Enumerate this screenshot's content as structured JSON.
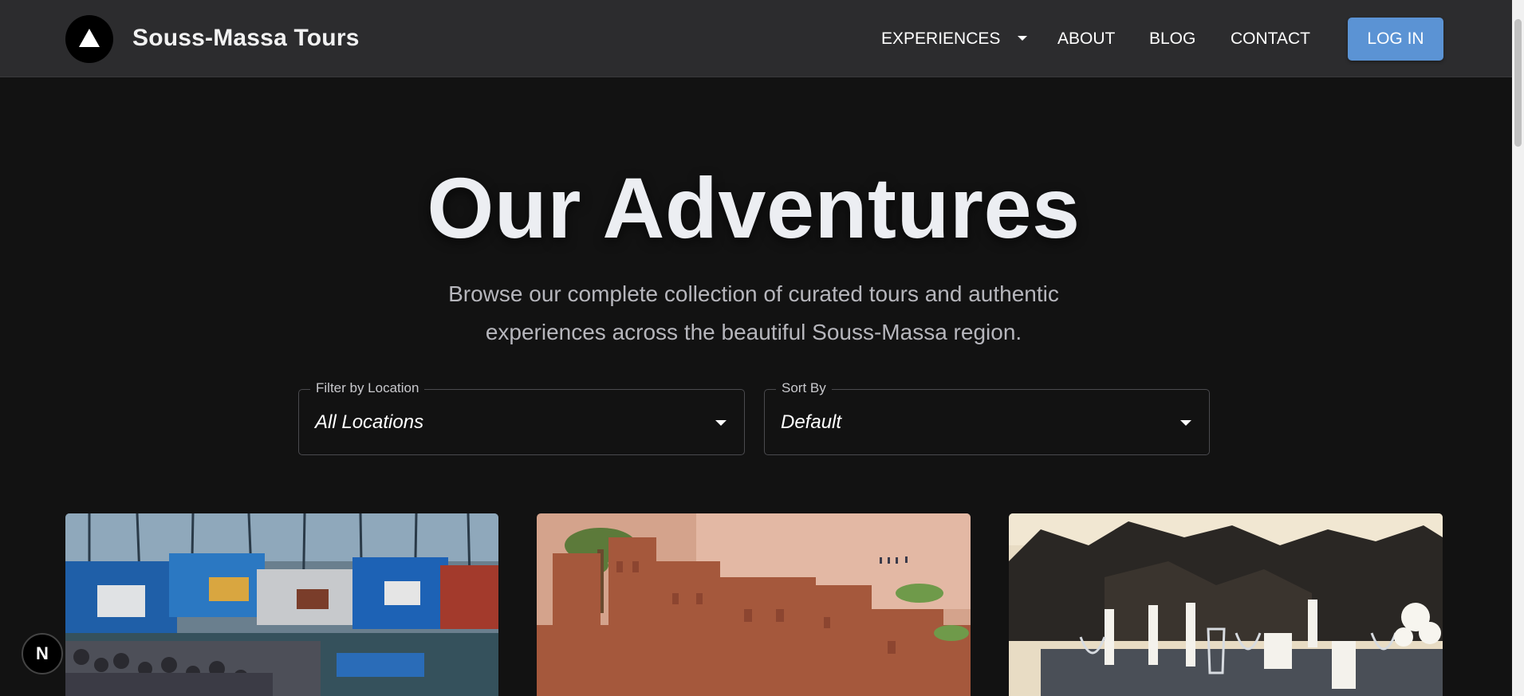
{
  "header": {
    "brand": "Souss-Massa Tours",
    "nav": {
      "experiences": "EXPERIENCES",
      "about": "ABOUT",
      "blog": "BLOG",
      "contact": "CONTACT"
    },
    "login": "LOG IN"
  },
  "hero": {
    "title": "Our Adventures",
    "subtitle": "Browse our complete collection of curated tours and authentic experiences across the beautiful Souss-Massa region."
  },
  "filters": {
    "location": {
      "label": "Filter by Location",
      "value": "All Locations"
    },
    "sort": {
      "label": "Sort By",
      "value": "Default"
    }
  },
  "colors": {
    "background": "#121212",
    "navbar": "#2c2c2e",
    "accent": "#5b93d4"
  },
  "icons": {
    "logo": "triangle-logo-icon",
    "dropdown": "caret-down-icon",
    "badge": "n"
  },
  "badge": {
    "label": "N"
  }
}
